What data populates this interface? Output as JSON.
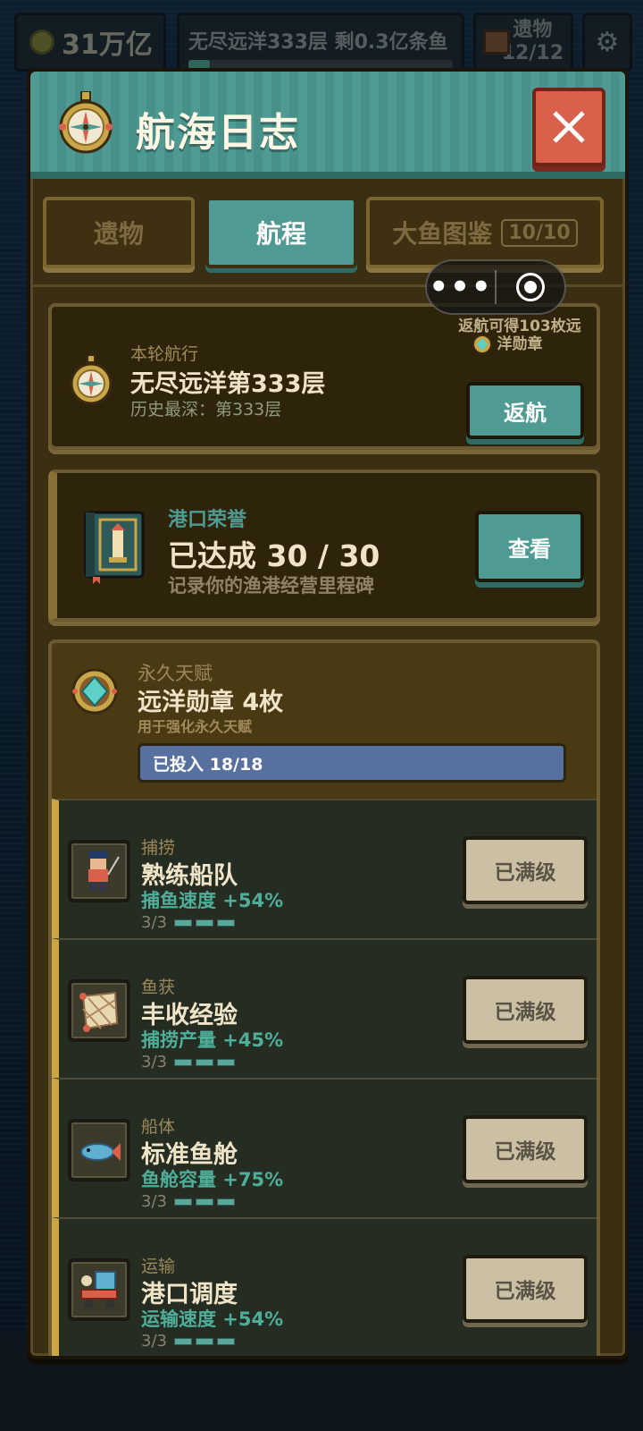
{
  "hud": {
    "coins": "31万亿",
    "progress_text": "无尽远洋333层 剩0.3亿条鱼",
    "progress_fraction": 0.08,
    "relics_label": "遗物",
    "relics_count": "12/12"
  },
  "modal": {
    "title": "航海日志",
    "icons": {
      "title": "compass-icon",
      "close": "close-icon"
    }
  },
  "tabs": [
    {
      "label": "遗物",
      "active": false
    },
    {
      "label": "航程",
      "active": true
    },
    {
      "label": "大鱼图鉴",
      "badge": "10/10",
      "active": false
    }
  ],
  "voyage": {
    "label": "本轮航行",
    "title": "无尽远洋第333层",
    "best": "历史最深：第333层",
    "reward_note": "返航可得103枚远洋勋章",
    "return_button": "返航"
  },
  "honor": {
    "label": "港口荣誉",
    "title": "已达成 30 / 30",
    "subtitle": "记录你的渔港经营里程碑",
    "view_button": "查看"
  },
  "talent": {
    "label": "永久天赋",
    "title": "远洋勋章 4枚",
    "subtitle": "用于强化永久天赋",
    "invested": "已投入 18/18",
    "maxed_label": "已满级",
    "items": [
      {
        "category": "捕捞",
        "name": "熟练船队",
        "effect": "捕鱼速度 +54%",
        "level": "3/3",
        "icon": "fisherman-icon"
      },
      {
        "category": "鱼获",
        "name": "丰收经验",
        "effect": "捕捞产量 +45%",
        "level": "3/3",
        "icon": "fishing-net-icon"
      },
      {
        "category": "船体",
        "name": "标准鱼舱",
        "effect": "鱼舱容量 +75%",
        "level": "3/3",
        "icon": "fish-icon"
      },
      {
        "category": "运输",
        "name": "港口调度",
        "effect": "运输速度 +54%",
        "level": "3/3",
        "icon": "cargo-cart-icon"
      }
    ]
  },
  "colors": {
    "teal": "#4f9a93",
    "close_red": "#d9604a",
    "effect_green": "#4fae9a",
    "invest_blue": "#5770a0"
  }
}
